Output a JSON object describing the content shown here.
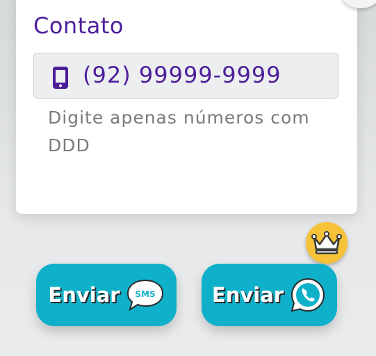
{
  "form": {
    "section_title": "Contato",
    "phone_value": "(92) 99999-9999",
    "helper_text": "Digite apenas números com DDD"
  },
  "buttons": {
    "sms_label": "Enviar",
    "whatsapp_label": "Enviar",
    "sms_icon_text": "SMS"
  },
  "icons": {
    "close": "close-icon",
    "phone": "mobile-phone-icon",
    "sms": "sms-bubble-icon",
    "whatsapp": "whatsapp-icon",
    "crown": "crown-icon"
  },
  "colors": {
    "accent_purple": "#4d1e9a",
    "button_teal": "#0fb0c9",
    "crown_gold": "#f5c238"
  }
}
